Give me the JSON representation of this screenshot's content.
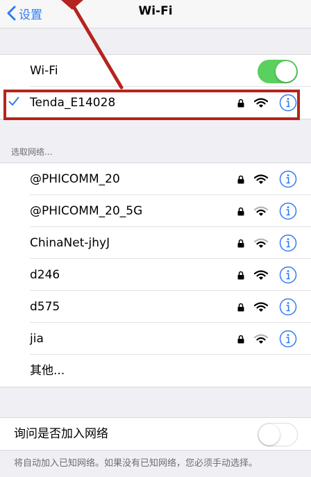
{
  "navbar": {
    "back_label": "设置",
    "title": "Wi-Fi"
  },
  "wifi_toggle": {
    "label": "Wi-Fi",
    "state": "on"
  },
  "connected_network": {
    "name": "Tenda_E14028",
    "secured": true,
    "signal": "strong"
  },
  "network_section": {
    "header": "选取网络...",
    "networks": [
      {
        "name": "@PHICOMM_20",
        "secured": true,
        "signal": "strong"
      },
      {
        "name": "@PHICOMM_20_5G",
        "secured": true,
        "signal": "medium"
      },
      {
        "name": "ChinaNet-jhyJ",
        "secured": true,
        "signal": "medium"
      },
      {
        "name": "d246",
        "secured": true,
        "signal": "strong"
      },
      {
        "name": "d575",
        "secured": true,
        "signal": "strong"
      },
      {
        "name": "jia",
        "secured": true,
        "signal": "medium"
      }
    ],
    "other_label": "其他..."
  },
  "ask_to_join": {
    "label": "询问是否加入网络",
    "state": "off",
    "note": "将自动加入已知网络。如果没有已知网络，您必须手动选择。"
  },
  "colors": {
    "accent": "#2f7bf5",
    "toggle_on": "#5ad05e",
    "annotation": "#b5241d"
  }
}
